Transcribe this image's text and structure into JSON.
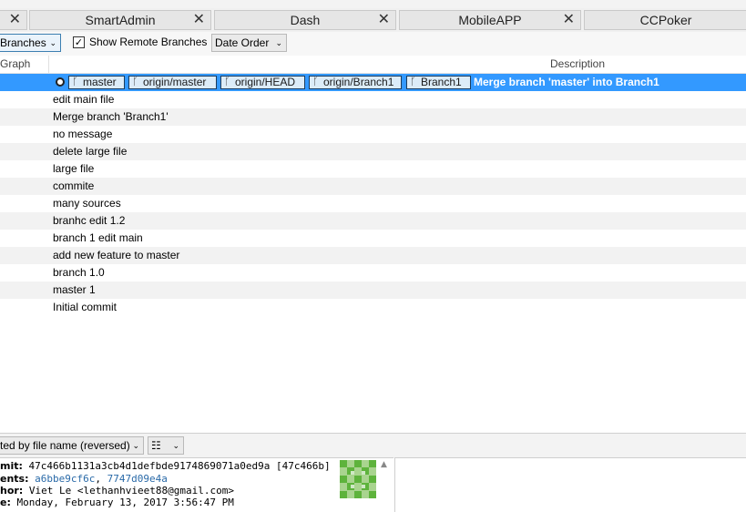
{
  "tabs": [
    {
      "label": ""
    },
    {
      "label": "SmartAdmin"
    },
    {
      "label": "Dash"
    },
    {
      "label": "MobileAPP"
    },
    {
      "label": "CCPoker"
    }
  ],
  "toolbar": {
    "branches_label": "Branches",
    "show_remote_label": "Show Remote Branches",
    "show_remote_checked": true,
    "order_label": "Date Order"
  },
  "columns": {
    "graph": "Graph",
    "description": "Description"
  },
  "selected_commit": {
    "refs": [
      "master",
      "origin/master",
      "origin/HEAD",
      "origin/Branch1",
      "Branch1"
    ],
    "message": "Merge branch 'master' into Branch1"
  },
  "commits": [
    "edit main file",
    "Merge branch 'Branch1'",
    "no message",
    "delete large file",
    "large file",
    "commite",
    "many sources",
    "branhc edit 1.2",
    "branch 1 edit main",
    "add new feature to master",
    "branch 1.0",
    "master 1",
    "Initial commit"
  ],
  "file_sort": {
    "label": "ted by file name (reversed)"
  },
  "details": {
    "commit_label": "mit:",
    "commit_value": "47c466b1131a3cb4d1defbde9174869071a0ed9a [47c466b]",
    "parents_label": "ents:",
    "parent1": "a6bbe9cf6c",
    "parent2": "7747d09e4a",
    "author_label": "hor:",
    "author_value": "Viet Le <lethanhvieet88@gmail.com>",
    "date_label": "e:",
    "date_value": "Monday, February 13, 2017 3:56:47 PM"
  }
}
